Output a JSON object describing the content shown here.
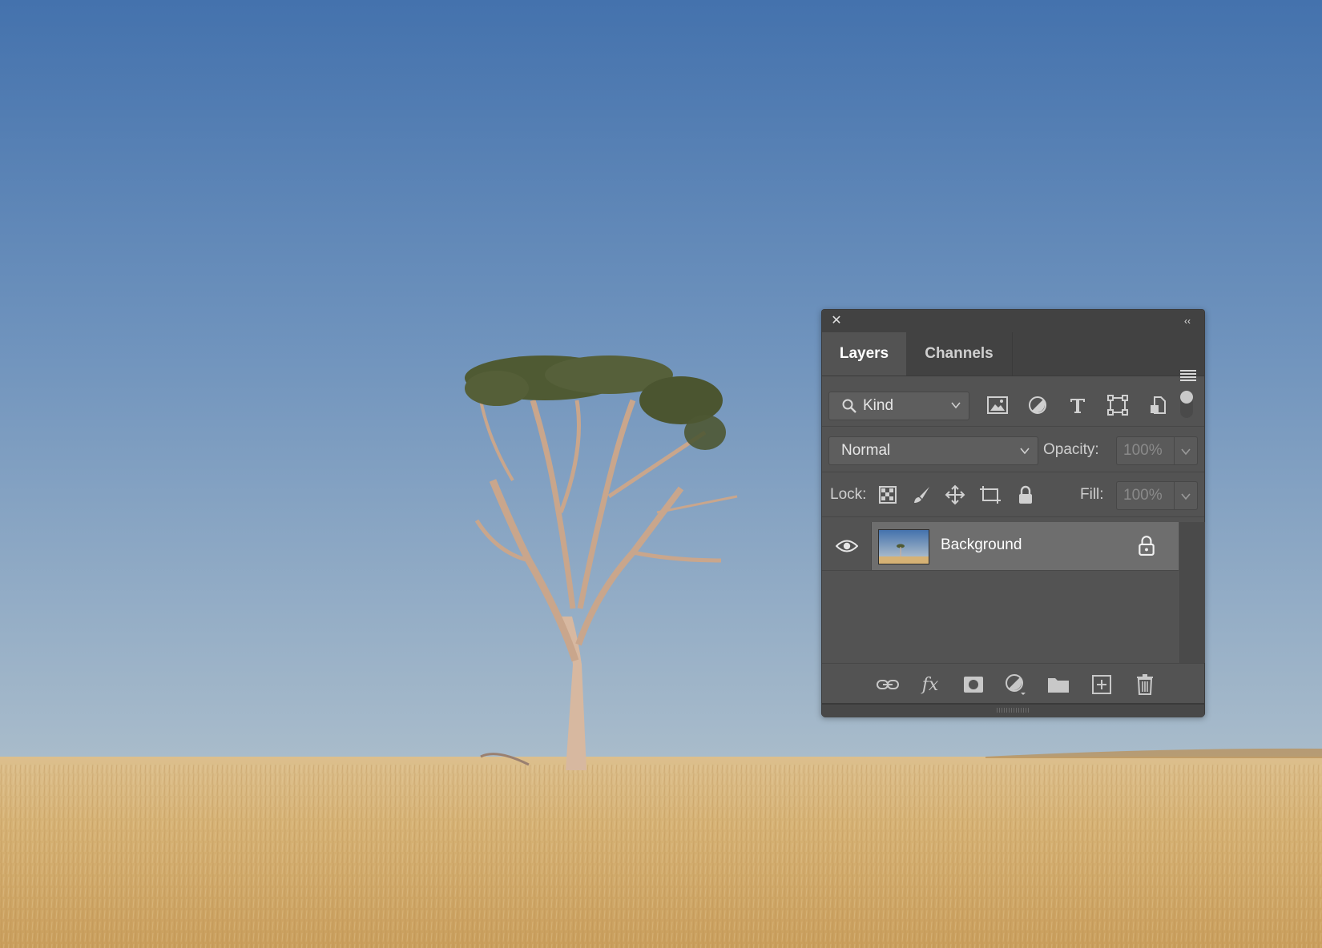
{
  "window": {
    "close_icon": "close-icon",
    "collapse_icon": "double-chevron-left-icon"
  },
  "tabs": [
    {
      "label": "Layers",
      "active": true
    },
    {
      "label": "Channels",
      "active": false
    }
  ],
  "filter": {
    "kind_label": "Kind",
    "icons": [
      "image-filter-icon",
      "adjustment-filter-icon",
      "type-filter-icon",
      "shape-filter-icon",
      "smart-object-filter-icon"
    ],
    "toggle_on": true
  },
  "blend": {
    "mode": "Normal",
    "opacity_label": "Opacity:",
    "opacity_value": "100%"
  },
  "lock": {
    "label": "Lock:",
    "icons": [
      "lock-transparent-pixels-icon",
      "lock-image-pixels-icon",
      "lock-position-icon",
      "lock-artboard-icon",
      "lock-all-icon"
    ],
    "fill_label": "Fill:",
    "fill_value": "100%"
  },
  "layers": [
    {
      "name": "Background",
      "visible": true,
      "locked": true
    }
  ],
  "footer_icons": [
    "link-layers-icon",
    "fx-icon",
    "layer-mask-icon",
    "adjustment-layer-icon",
    "group-folder-icon",
    "new-layer-icon",
    "trash-icon"
  ],
  "colors": {
    "panel_bg": "#535353",
    "panel_dark": "#424242",
    "selected_row": "#6e6e6e",
    "sky_top": "#4472ad",
    "sky_bottom": "#a4b6c8",
    "field": "#d8b47a"
  }
}
